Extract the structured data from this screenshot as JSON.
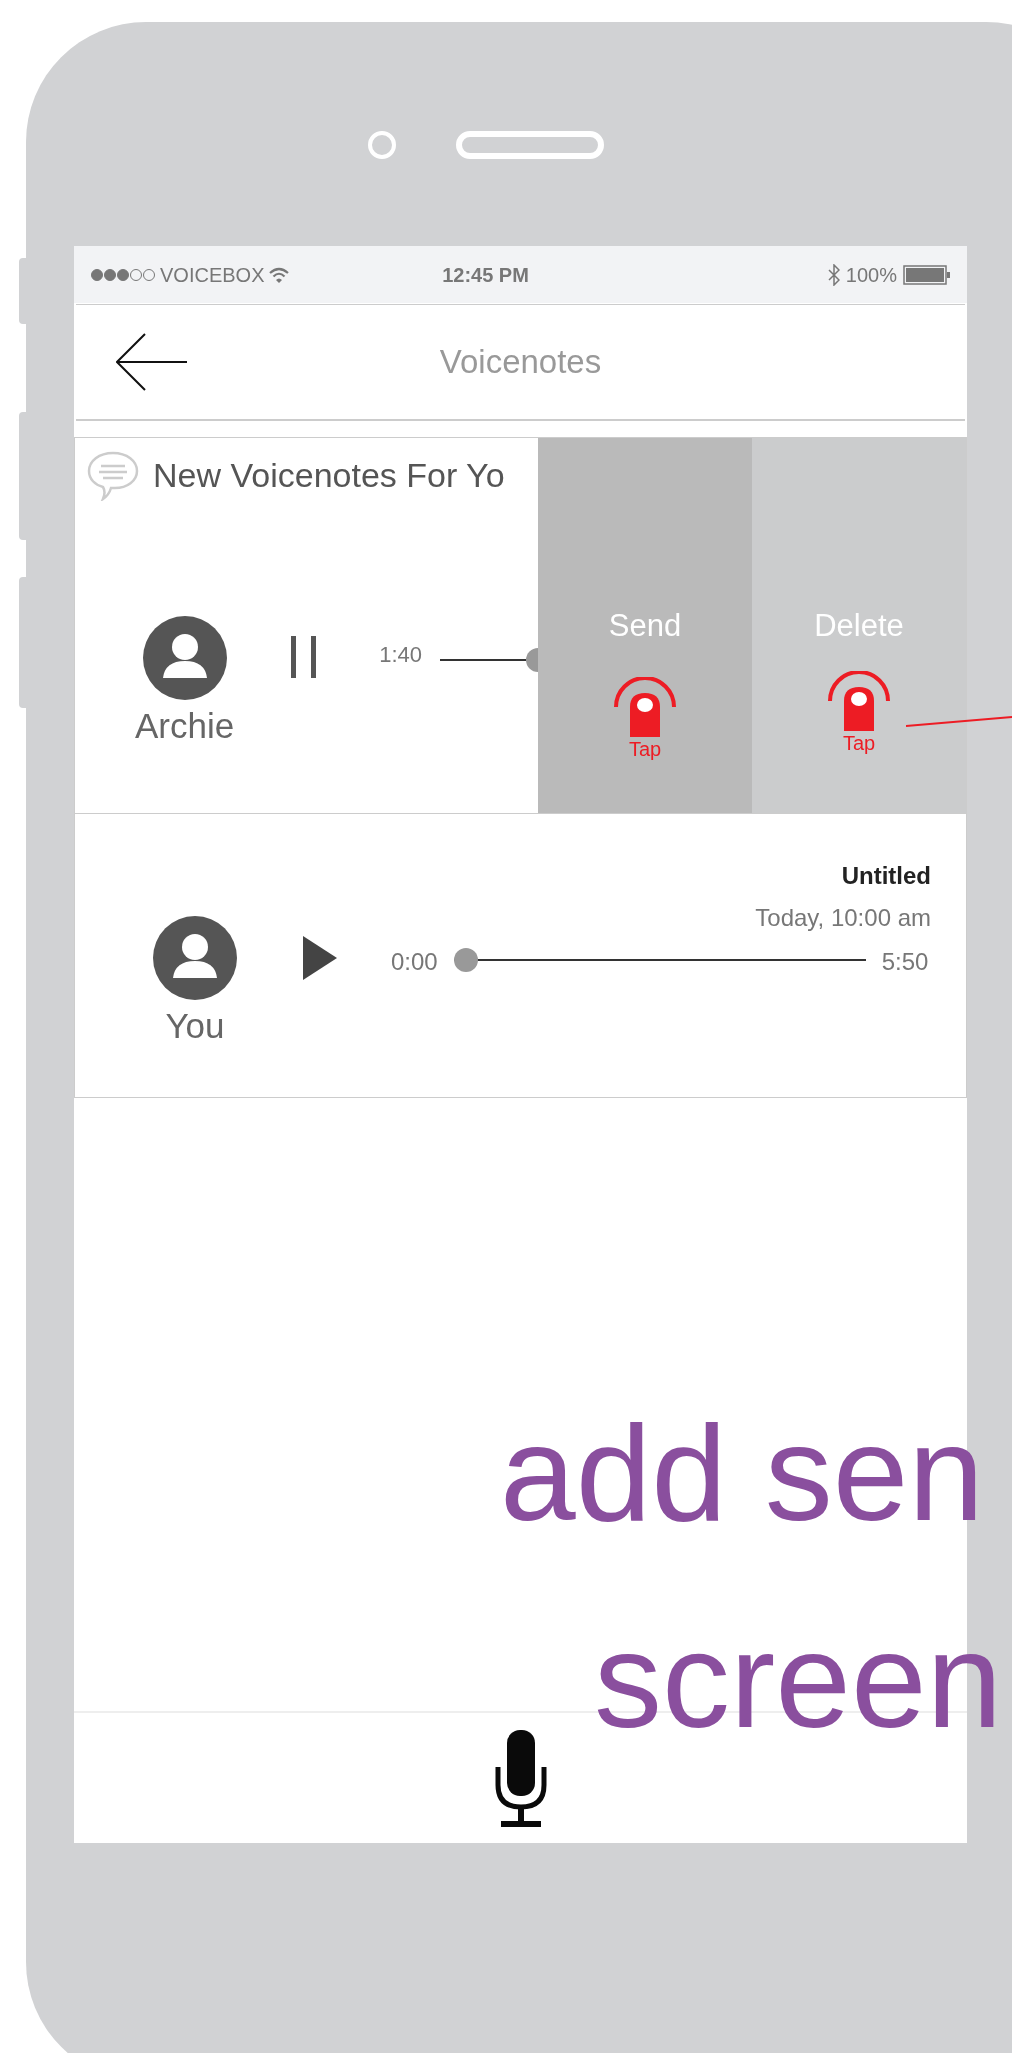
{
  "status_bar": {
    "carrier": "VOICEBOX",
    "time": "12:45 PM",
    "battery": "100%"
  },
  "nav": {
    "title": "Voicenotes"
  },
  "notes": [
    {
      "header": "New Voicenotes For Yo",
      "name": "Archie",
      "playing": true,
      "elapsed": "1:40",
      "actions": [
        {
          "kind": "send",
          "label": "Send",
          "hint": "Tap"
        },
        {
          "kind": "delete",
          "label": "Delete",
          "hint": "Tap"
        }
      ]
    },
    {
      "title": "Untitled",
      "date": "Today, 10:00 am",
      "name": "You",
      "playing": false,
      "elapsed": "0:00",
      "duration": "5:50",
      "level": 0
    }
  ],
  "annotation": [
    "add sen",
    "screen"
  ]
}
